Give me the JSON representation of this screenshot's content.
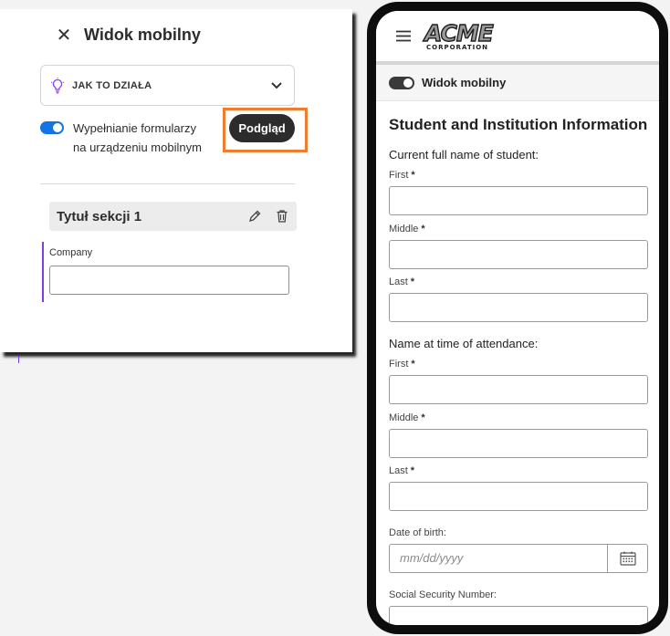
{
  "panel": {
    "title": "Widok mobilny",
    "howto_label": "JAK TO DZIAŁA",
    "toggle_label": "Wypełnianie formularzy na urządzeniu mobilnym",
    "preview_button": "Podgląd",
    "section_title": "Tytuł sekcji 1",
    "company_label": "Company",
    "icons": [
      "close-icon",
      "lightbulb-icon",
      "chevron-down-icon",
      "pencil-icon",
      "trash-icon"
    ]
  },
  "phone": {
    "logo_main": "ACME",
    "logo_sub": "CORPORATION",
    "mobile_view_label": "Widok mobilny",
    "form": {
      "title": "Student and Institution Information",
      "group_current": "Current full name of student:",
      "group_attendance": "Name at time of attendance:",
      "first": "First",
      "middle": "Middle",
      "last": "Last",
      "required_mark": "*",
      "dob_label": "Date of birth:",
      "dob_placeholder": "mm/dd/yyyy",
      "ssn_label": "Social Security Number:"
    }
  },
  "colors": {
    "accent_blue": "#1473e6",
    "highlight_orange": "#ee7d2f",
    "section_accent_purple": "#7b3fe4"
  }
}
